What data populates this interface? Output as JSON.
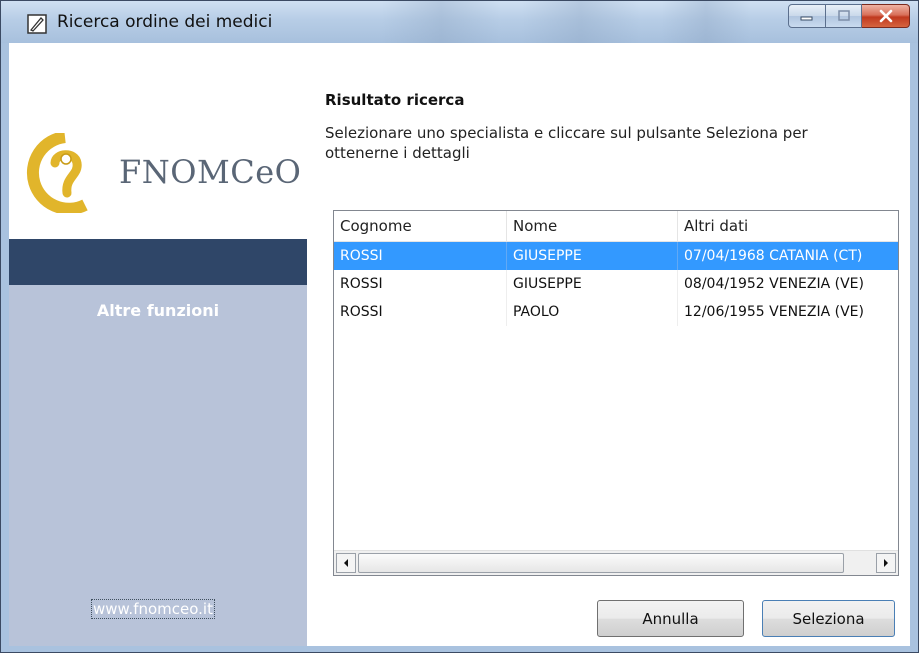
{
  "window": {
    "title": "Ricerca ordine dei medici"
  },
  "sidebar": {
    "logo_text": "FNOMCeO",
    "section_title": "Altre funzioni",
    "website_link": "www.fnomceo.it"
  },
  "main": {
    "results_title": "Risultato ricerca",
    "instructions": "Selezionare uno specialista e cliccare sul pulsante Seleziona per ottenerne i dettagli"
  },
  "list": {
    "columns": [
      "Cognome",
      "Nome",
      "Altri dati"
    ],
    "selected_row": 0,
    "rows": [
      [
        "ROSSI",
        "GIUSEPPE",
        "07/04/1968 CATANIA (CT)"
      ],
      [
        "ROSSI",
        "GIUSEPPE",
        "08/04/1952 VENEZIA (VE)"
      ],
      [
        "ROSSI",
        "PAOLO",
        "12/06/1955 VENEZIA (VE)"
      ]
    ]
  },
  "buttons": {
    "cancel": "Annulla",
    "select": "Seleziona"
  },
  "colors": {
    "selection": "#3399ff",
    "sidebar_dark": "#2f4668",
    "sidebar_body": "#b8c3d9",
    "logo_gold": "#e1b52b"
  },
  "icons": {
    "app": "app-window-icon",
    "minimize": "minimize-icon",
    "maximize": "maximize-icon",
    "close": "close-icon",
    "logo": "fnomceo-logo-icon",
    "scroll_left": "scroll-left-arrow-icon",
    "scroll_right": "scroll-right-arrow-icon"
  }
}
